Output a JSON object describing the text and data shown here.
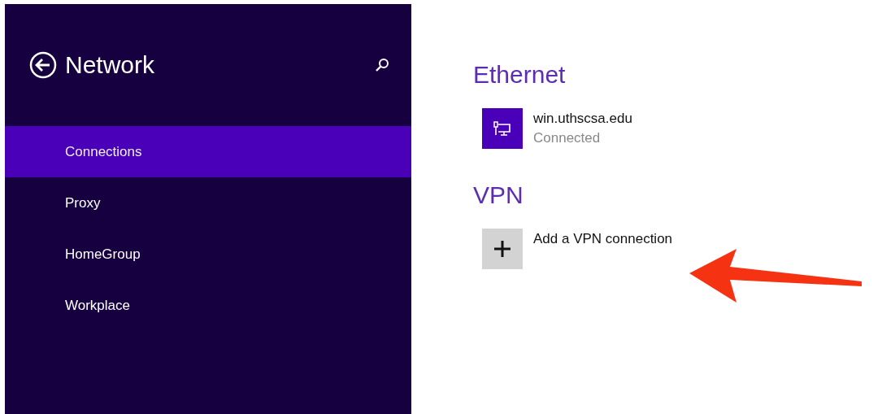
{
  "sidebar": {
    "title": "Network",
    "items": [
      {
        "label": "Connections",
        "selected": true
      },
      {
        "label": "Proxy",
        "selected": false
      },
      {
        "label": "HomeGroup",
        "selected": false
      },
      {
        "label": "Workplace",
        "selected": false
      }
    ]
  },
  "sections": [
    {
      "heading": "Ethernet",
      "items": [
        {
          "kind": "network",
          "name": "win.uthscsa.edu",
          "status": "Connected"
        }
      ]
    },
    {
      "heading": "VPN",
      "items": [
        {
          "kind": "add",
          "name": "Add a VPN connection"
        }
      ]
    }
  ]
}
